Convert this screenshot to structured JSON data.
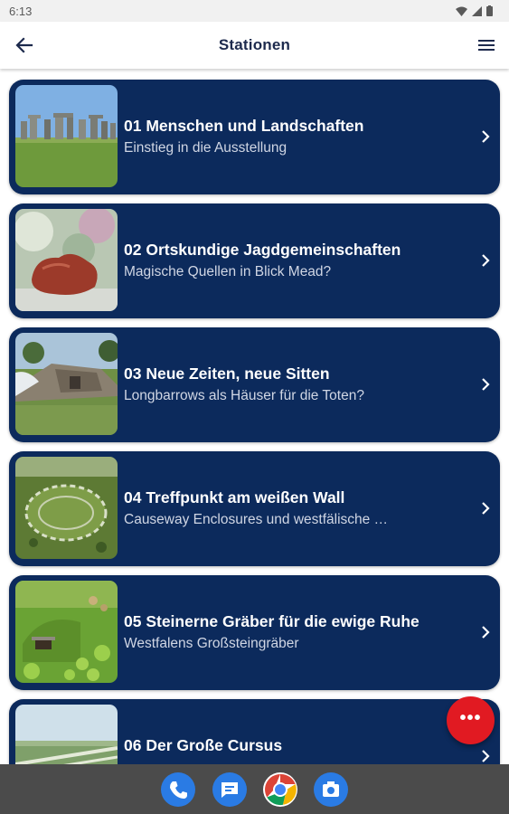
{
  "status_bar": {
    "time": "6:13"
  },
  "app_bar": {
    "title": "Stationen"
  },
  "stations": [
    {
      "title": "01 Menschen und Landschaften",
      "subtitle": "Einstieg in die Ausstellung"
    },
    {
      "title": "02 Ortskundige Jagdgemeinschaften",
      "subtitle": "Magische Quellen in Blick Mead?"
    },
    {
      "title": "03 Neue Zeiten, neue Sitten",
      "subtitle": "Longbarrows als Häuser für die Toten?"
    },
    {
      "title": "04 Treffpunkt am weißen Wall",
      "subtitle": "Causeway Enclosures und westfälische …"
    },
    {
      "title": "05 Steinerne Gräber für die ewige Ruhe",
      "subtitle": "Westfalens Großsteingräber"
    },
    {
      "title": "06 Der Große Cursus",
      "subtitle": ""
    }
  ],
  "fab": {
    "icon": "more-horizontal-icon",
    "label": "•••"
  },
  "nav_bar": {
    "apps": [
      "phone-icon",
      "messages-icon",
      "chrome-icon",
      "camera-icon"
    ]
  },
  "colors": {
    "card": "#0c2a5c",
    "fab": "#e11a22",
    "title": "#1d2a4d"
  }
}
